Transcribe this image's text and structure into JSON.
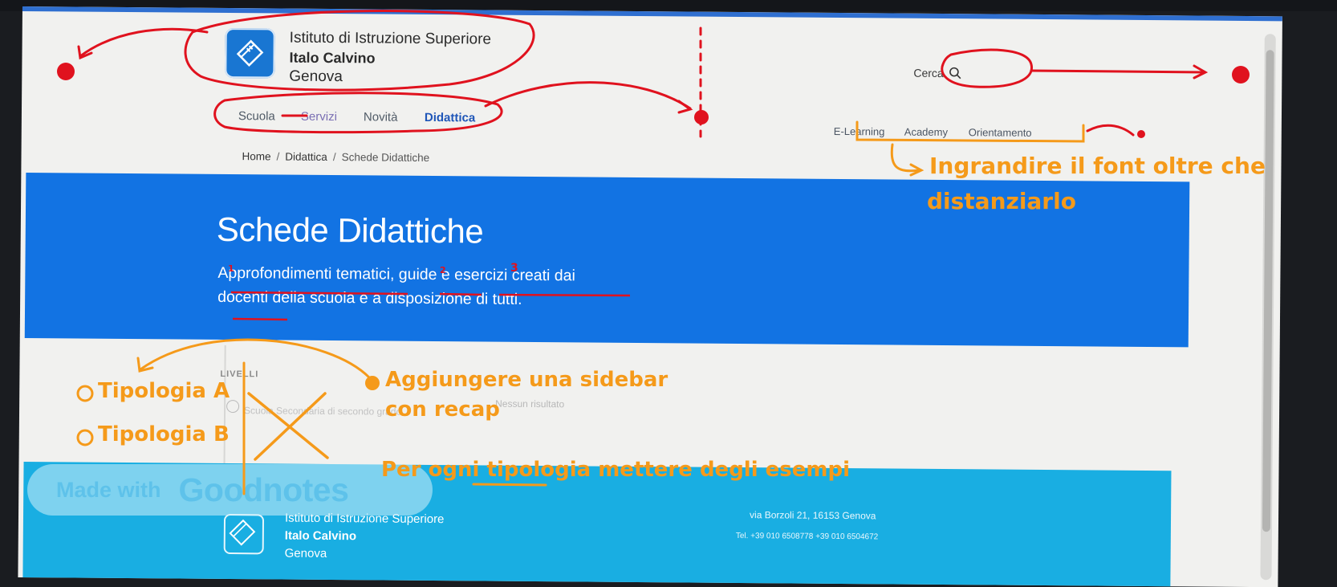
{
  "header": {
    "school_line1": "Istituto di Istruzione Superiore",
    "school_line2": "Italo Calvino",
    "school_line3": "Genova",
    "search_label": "Cerca"
  },
  "nav": {
    "items": [
      {
        "label": "Scuola"
      },
      {
        "label": "Servizi"
      },
      {
        "label": "Novità"
      },
      {
        "label": "Didattica"
      }
    ]
  },
  "subnav": {
    "items": [
      {
        "label": "E-Learning"
      },
      {
        "label": "Academy"
      },
      {
        "label": "Orientamento"
      }
    ]
  },
  "breadcrumb": {
    "items": [
      "Home",
      "Didattica",
      "Schede Didattiche"
    ],
    "separator": "/"
  },
  "hero": {
    "title": "Schede Didattiche",
    "description": "Approfondimenti tematici, guide e esercizi creati dai docenti della scuola e a disposizione di tutti."
  },
  "filters": {
    "levels_label": "LIVELLI",
    "option_label": "Scuola Secondaria di secondo grado",
    "no_results": "Nessun risultato"
  },
  "footer": {
    "school_line1": "Istituto di Istruzione Superiore",
    "school_line2": "Italo Calvino",
    "school_line3": "Genova",
    "address": "via Borzoli 21, 16153 Genova",
    "phone": "Tel. +39 010 6508778   +39 010 6504672"
  },
  "watermark": {
    "small": "Made with",
    "big": "Goodnotes"
  },
  "annotations": {
    "font_note_line1": "Ingrandire il font oltre che",
    "font_note_line2": "distanziarlo",
    "sidebar_note_line1": "Aggiungere una sidebar",
    "sidebar_note_line2": "con recap",
    "examples_note": "Per ogni tipologia mettere degli esempi",
    "type_a": "Tipologia A",
    "type_b": "Tipologia B",
    "marker_1": "1",
    "marker_2": "2",
    "marker_3": "3"
  },
  "colors": {
    "hero_blue": "#1273e3",
    "footer_blue": "#19aee2",
    "annotation_red": "#e0121e",
    "annotation_orange": "#f59a1a"
  }
}
